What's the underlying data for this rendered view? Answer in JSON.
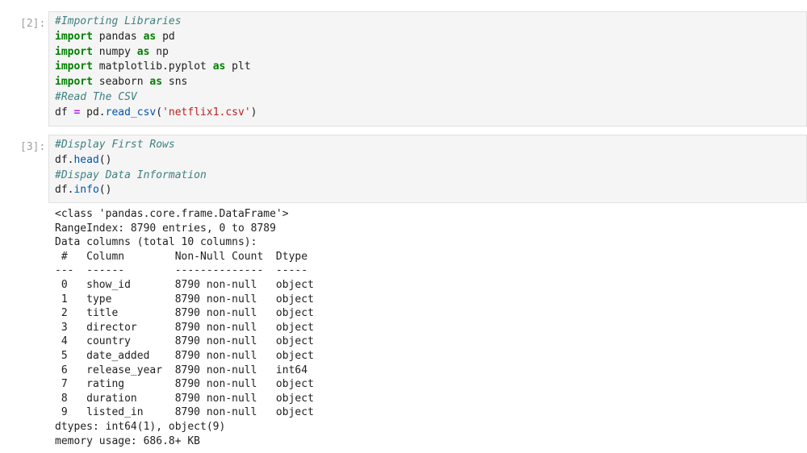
{
  "cells": [
    {
      "prompt": "[2]:",
      "lines": [
        [
          {
            "t": "#Importing Libraries",
            "c": "cm"
          }
        ],
        [
          {
            "t": "import",
            "c": "kw"
          },
          {
            "t": " pandas ",
            "c": ""
          },
          {
            "t": "as",
            "c": "kw"
          },
          {
            "t": " pd",
            "c": ""
          }
        ],
        [
          {
            "t": "import",
            "c": "kw"
          },
          {
            "t": " numpy ",
            "c": ""
          },
          {
            "t": "as",
            "c": "kw"
          },
          {
            "t": " np",
            "c": ""
          }
        ],
        [
          {
            "t": "import",
            "c": "kw"
          },
          {
            "t": " matplotlib.pyplot ",
            "c": ""
          },
          {
            "t": "as",
            "c": "kw"
          },
          {
            "t": " plt",
            "c": ""
          }
        ],
        [
          {
            "t": "import",
            "c": "kw"
          },
          {
            "t": " seaborn ",
            "c": ""
          },
          {
            "t": "as",
            "c": "kw"
          },
          {
            "t": " sns",
            "c": ""
          }
        ],
        [
          {
            "t": "#Read The CSV",
            "c": "cm"
          }
        ],
        [
          {
            "t": "df ",
            "c": ""
          },
          {
            "t": "=",
            "c": "op"
          },
          {
            "t": " pd.",
            "c": ""
          },
          {
            "t": "read_csv",
            "c": "fn"
          },
          {
            "t": "(",
            "c": ""
          },
          {
            "t": "'netflix1.csv'",
            "c": "st"
          },
          {
            "t": ")",
            "c": ""
          }
        ]
      ]
    },
    {
      "prompt": "[3]:",
      "lines": [
        [
          {
            "t": "#Display First Rows",
            "c": "cm"
          }
        ],
        [
          {
            "t": "df.",
            "c": ""
          },
          {
            "t": "head",
            "c": "fn"
          },
          {
            "t": "()",
            "c": ""
          }
        ],
        [
          {
            "t": "#Dispay Data Information",
            "c": "cm"
          }
        ],
        [
          {
            "t": "df.",
            "c": ""
          },
          {
            "t": "info",
            "c": "fn"
          },
          {
            "t": "()",
            "c": ""
          }
        ]
      ],
      "output": [
        "<class 'pandas.core.frame.DataFrame'>",
        "RangeIndex: 8790 entries, 0 to 8789",
        "Data columns (total 10 columns):",
        " #   Column        Non-Null Count  Dtype ",
        "---  ------        --------------  ----- ",
        " 0   show_id       8790 non-null   object",
        " 1   type          8790 non-null   object",
        " 2   title         8790 non-null   object",
        " 3   director      8790 non-null   object",
        " 4   country       8790 non-null   object",
        " 5   date_added    8790 non-null   object",
        " 6   release_year  8790 non-null   int64 ",
        " 7   rating        8790 non-null   object",
        " 8   duration      8790 non-null   object",
        " 9   listed_in     8790 non-null   object",
        "dtypes: int64(1), object(9)",
        "memory usage: 686.8+ KB"
      ]
    }
  ]
}
